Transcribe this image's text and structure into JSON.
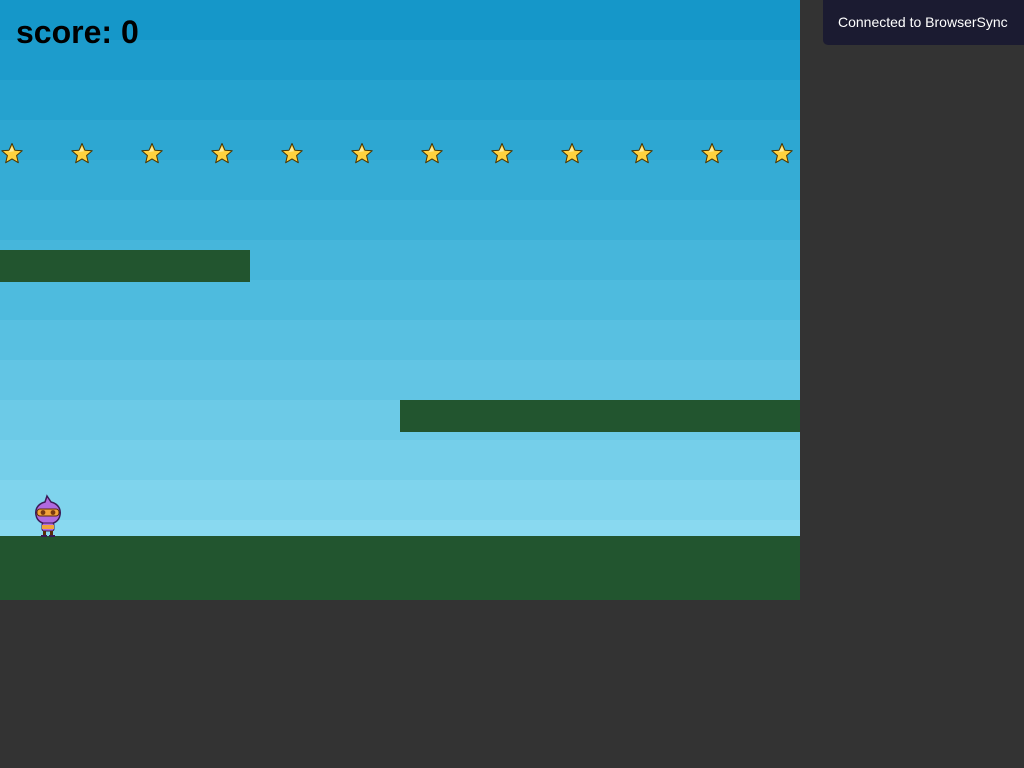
{
  "hud": {
    "score_label": "score: 0"
  },
  "game": {
    "stars_count": 12,
    "star_icon": "star-icon",
    "player_icon": "purple-dude-icon",
    "colors": {
      "platform": "#22552f",
      "star_fill": "#ffd23f",
      "background": "#333333",
      "sky_top": "#1597c9",
      "sky_bottom": "#89d9f0"
    }
  },
  "notification": {
    "text": "Connected to BrowserSync"
  }
}
